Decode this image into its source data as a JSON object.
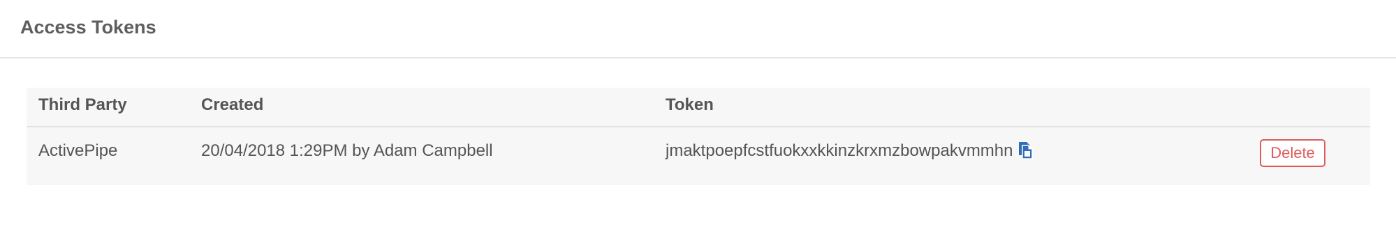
{
  "panel": {
    "title": "Access Tokens"
  },
  "table": {
    "columns": {
      "third_party": "Third Party",
      "created": "Created",
      "token": "Token"
    },
    "rows": [
      {
        "third_party": "ActivePipe",
        "created": "20/04/2018 1:29PM by Adam Campbell",
        "token": "jmaktpoepfcstfuokxxkkinzkrxmzbowpakvmmhn",
        "delete_label": "Delete"
      }
    ]
  },
  "colors": {
    "copy_icon": "#2f6db5",
    "delete_button": "#e05a5a",
    "row_background": "#f7f7f7"
  },
  "icons": {
    "copy": "copy-icon"
  }
}
